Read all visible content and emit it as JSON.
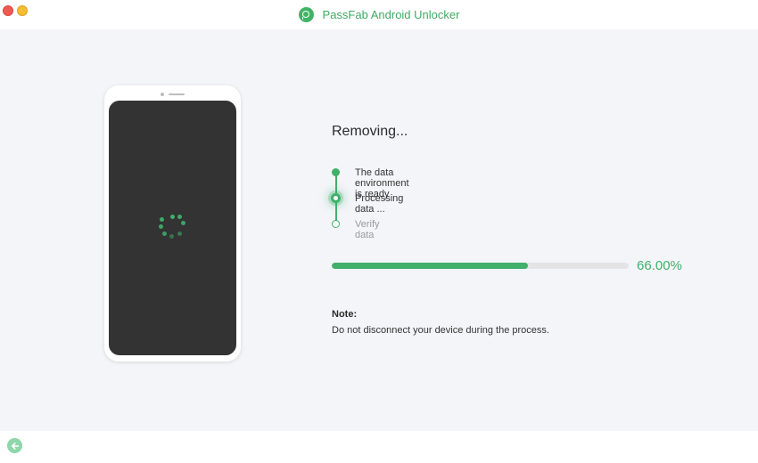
{
  "window": {
    "title": "PassFab Android Unlocker"
  },
  "status": {
    "heading": "Removing...",
    "steps": [
      {
        "label": "The data environment is ready",
        "state": "done"
      },
      {
        "label": "Processing data ...",
        "state": "active"
      },
      {
        "label": "Verify data",
        "state": "pending"
      }
    ],
    "progress": {
      "percent_label": "66.00%",
      "value": 0.66
    }
  },
  "note": {
    "title": "Note:",
    "text": "Do not disconnect your device during the process."
  },
  "footer": {
    "back_icon": "arrow-left-icon"
  },
  "colors": {
    "accent": "#40b06a",
    "window_bg": "#f4f5f9",
    "phone_screen": "#333333",
    "close": "#ee5a52",
    "minimize": "#f5bd31"
  }
}
